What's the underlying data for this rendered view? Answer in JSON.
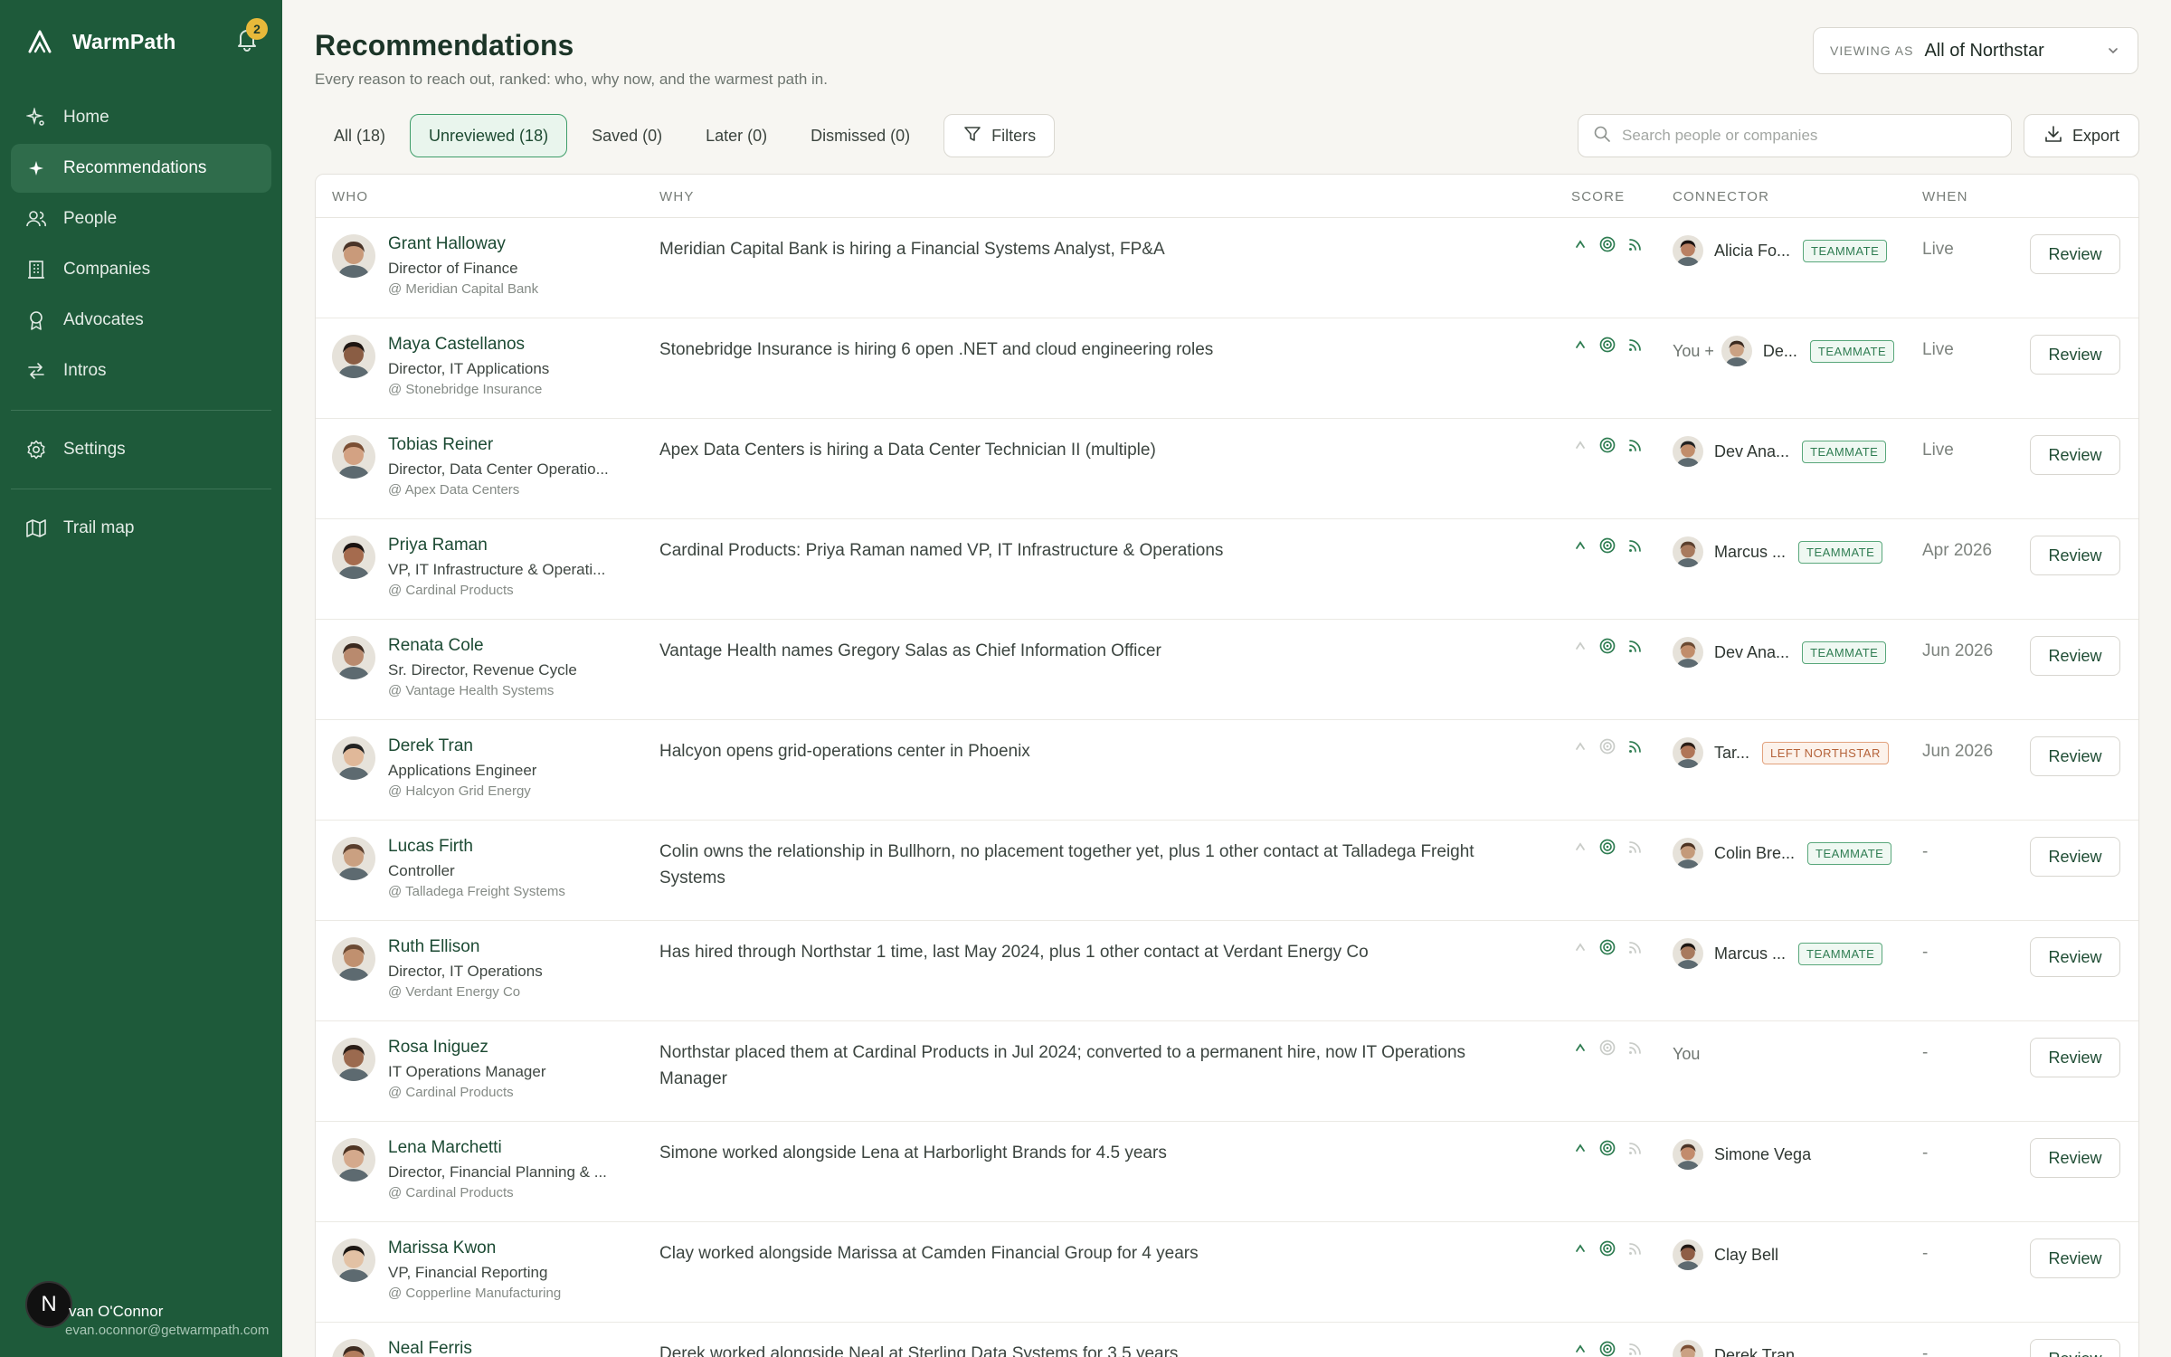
{
  "app": {
    "name": "WarmPath",
    "notification_count": "2"
  },
  "sidebar": {
    "items": [
      {
        "label": "Home",
        "icon": "sparkle-home-icon"
      },
      {
        "label": "Recommendations",
        "icon": "star-icon",
        "active": true
      },
      {
        "label": "People",
        "icon": "people-icon"
      },
      {
        "label": "Companies",
        "icon": "building-icon"
      },
      {
        "label": "Advocates",
        "icon": "badge-icon"
      },
      {
        "label": "Intros",
        "icon": "arrows-icon"
      }
    ],
    "settings_label": "Settings",
    "trail_label": "Trail map",
    "user": {
      "initial": "N",
      "name": "van O'Connor",
      "email": "evan.oconnor@getwarmpath.com"
    }
  },
  "header": {
    "title": "Recommendations",
    "subtitle": "Every reason to reach out, ranked: who, why now, and the warmest path in.",
    "viewing_label": "VIEWING AS",
    "viewing_value": "All of Northstar"
  },
  "tabs": [
    {
      "label": "All (18)"
    },
    {
      "label": "Unreviewed (18)",
      "active": true
    },
    {
      "label": "Saved (0)"
    },
    {
      "label": "Later (0)"
    },
    {
      "label": "Dismissed (0)"
    }
  ],
  "filters_label": "Filters",
  "search_placeholder": "Search people or companies",
  "export_label": "Export",
  "columns": {
    "who": "WHO",
    "why": "WHY",
    "score": "SCORE",
    "connector": "CONNECTOR",
    "when": "WHEN"
  },
  "review_label": "Review",
  "colors": {
    "sidebar": "#1e5a3a",
    "accent": "#3e9d69",
    "score_active": "#2f7d52",
    "score_inactive": "#c9ccc8"
  },
  "rows": [
    {
      "name": "Grant Halloway",
      "role": "Director of Finance",
      "company": "@ Meridian Capital Bank",
      "why": "Meridian Capital Bank is hiring a Financial Systems Analyst, FP&A",
      "score": [
        true,
        true,
        true
      ],
      "you": "",
      "connector": "Alicia Fo...",
      "badge": "TEAMMATE",
      "badge_type": "team",
      "when": "Live"
    },
    {
      "name": "Maya Castellanos",
      "role": "Director, IT Applications",
      "company": "@ Stonebridge Insurance",
      "why": "Stonebridge Insurance is hiring 6 open .NET and cloud engineering roles",
      "score": [
        true,
        true,
        true
      ],
      "you": "You +",
      "connector": "De...",
      "badge": "TEAMMATE",
      "badge_type": "team",
      "when": "Live"
    },
    {
      "name": "Tobias Reiner",
      "role": "Director, Data Center Operatio...",
      "company": "@ Apex Data Centers",
      "why": "Apex Data Centers is hiring a Data Center Technician II (multiple)",
      "score": [
        false,
        true,
        true
      ],
      "you": "",
      "connector": "Dev Ana...",
      "badge": "TEAMMATE",
      "badge_type": "team",
      "when": "Live"
    },
    {
      "name": "Priya Raman",
      "role": "VP, IT Infrastructure & Operati...",
      "company": "@ Cardinal Products",
      "why": "Cardinal Products: Priya Raman named VP, IT Infrastructure & Operations",
      "score": [
        true,
        true,
        true
      ],
      "you": "",
      "connector": "Marcus ...",
      "badge": "TEAMMATE",
      "badge_type": "team",
      "when": "Apr 2026"
    },
    {
      "name": "Renata Cole",
      "role": "Sr. Director, Revenue Cycle",
      "company": "@ Vantage Health Systems",
      "why": "Vantage Health names Gregory Salas as Chief Information Officer",
      "score": [
        false,
        true,
        true
      ],
      "you": "",
      "connector": "Dev Ana...",
      "badge": "TEAMMATE",
      "badge_type": "team",
      "when": "Jun 2026"
    },
    {
      "name": "Derek Tran",
      "role": "Applications Engineer",
      "company": "@ Halcyon Grid Energy",
      "why": "Halcyon opens grid-operations center in Phoenix",
      "score": [
        false,
        false,
        true
      ],
      "you": "",
      "connector": "Tar...",
      "badge": "LEFT NORTHSTAR",
      "badge_type": "left",
      "when": "Jun 2026"
    },
    {
      "name": "Lucas Firth",
      "role": "Controller",
      "company": "@ Talladega Freight Systems",
      "why": "Colin owns the relationship in Bullhorn, no placement together yet, plus 1 other contact at Talladega Freight Systems",
      "score": [
        false,
        true,
        false
      ],
      "you": "",
      "connector": "Colin Bre...",
      "badge": "TEAMMATE",
      "badge_type": "team",
      "when": "-"
    },
    {
      "name": "Ruth Ellison",
      "role": "Director, IT Operations",
      "company": "@ Verdant Energy Co",
      "why": "Has hired through Northstar 1 time, last May 2024, plus 1 other contact at Verdant Energy Co",
      "score": [
        false,
        true,
        false
      ],
      "you": "",
      "connector": "Marcus ...",
      "badge": "TEAMMATE",
      "badge_type": "team",
      "when": "-"
    },
    {
      "name": "Rosa Iniguez",
      "role": "IT Operations Manager",
      "company": "@ Cardinal Products",
      "why": "Northstar placed them at Cardinal Products in Jul 2024; converted to a permanent hire, now IT Operations Manager",
      "score": [
        true,
        false,
        false
      ],
      "you": "You",
      "connector": "",
      "badge": "",
      "badge_type": "",
      "when": "-"
    },
    {
      "name": "Lena Marchetti",
      "role": "Director, Financial Planning & ...",
      "company": "@ Cardinal Products",
      "why": "Simone worked alongside Lena at Harborlight Brands for 4.5 years",
      "score": [
        true,
        true,
        false
      ],
      "you": "",
      "connector": "Simone Vega",
      "badge": "",
      "badge_type": "",
      "when": "-"
    },
    {
      "name": "Marissa Kwon",
      "role": "VP, Financial Reporting",
      "company": "@ Copperline Manufacturing",
      "why": "Clay worked alongside Marissa at Camden Financial Group for 4 years",
      "score": [
        true,
        true,
        false
      ],
      "you": "",
      "connector": "Clay Bell",
      "badge": "",
      "badge_type": "",
      "when": "-"
    },
    {
      "name": "Neal Ferris",
      "role": "",
      "company": "",
      "why": "Derek worked alongside Neal at Sterling Data Systems for 3.5 years",
      "score": [
        true,
        true,
        false
      ],
      "you": "",
      "connector": "Derek Tran",
      "badge": "",
      "badge_type": "",
      "when": "-"
    }
  ]
}
